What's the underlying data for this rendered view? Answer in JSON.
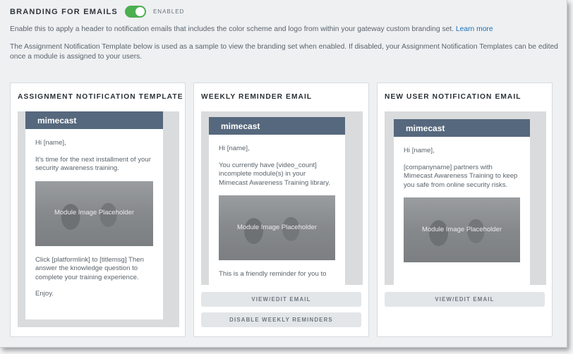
{
  "section": {
    "title": "BRANDING FOR EMAILS",
    "toggle_label": "ENABLED",
    "toggle_on": true,
    "accent_color": "#4caf50",
    "description": "Enable this to apply a header to notification emails that includes the color scheme and logo from within your gateway custom branding set.",
    "learn_more": "Learn more",
    "note": "The Assignment Notification Template below is used as a sample to view the branding set when enabled. If disabled, your Assignment Notification Templates can be edited once a module is assigned to your users."
  },
  "cards": [
    {
      "title": "ASSIGNMENT NOTIFICATION TEMPLATE",
      "brand": "mimecast",
      "greeting": "Hi [name],",
      "intro": "It's time for the next installment of your security awareness training.",
      "image_placeholder": "Module Image Placeholder",
      "after_image": "Click [platformlink] to [titlemsg] Then answer the knowledge question to complete your training experience.",
      "closing": "Enjoy."
    },
    {
      "title": "WEEKLY REMINDER EMAIL",
      "brand": "mimecast",
      "greeting": "Hi [name],",
      "intro": "You currently have [video_count] incomplete module(s) in your Mimecast Awareness Training library.",
      "image_placeholder": "Module Image Placeholder",
      "after_image": "This is a friendly reminder for you to",
      "buttons": [
        "VIEW/EDIT EMAIL",
        "DISABLE WEEKLY REMINDERS"
      ]
    },
    {
      "title": "NEW USER NOTIFICATION EMAIL",
      "brand": "mimecast",
      "greeting": "Hi [name],",
      "intro": "[companyname] partners with Mimecast Awareness Training to keep you safe from online security risks.",
      "image_placeholder": "Module Image Placeholder",
      "buttons": [
        "VIEW/EDIT EMAIL"
      ]
    }
  ],
  "colors": {
    "email_header": "#56687d",
    "link": "#1a6fb5"
  }
}
